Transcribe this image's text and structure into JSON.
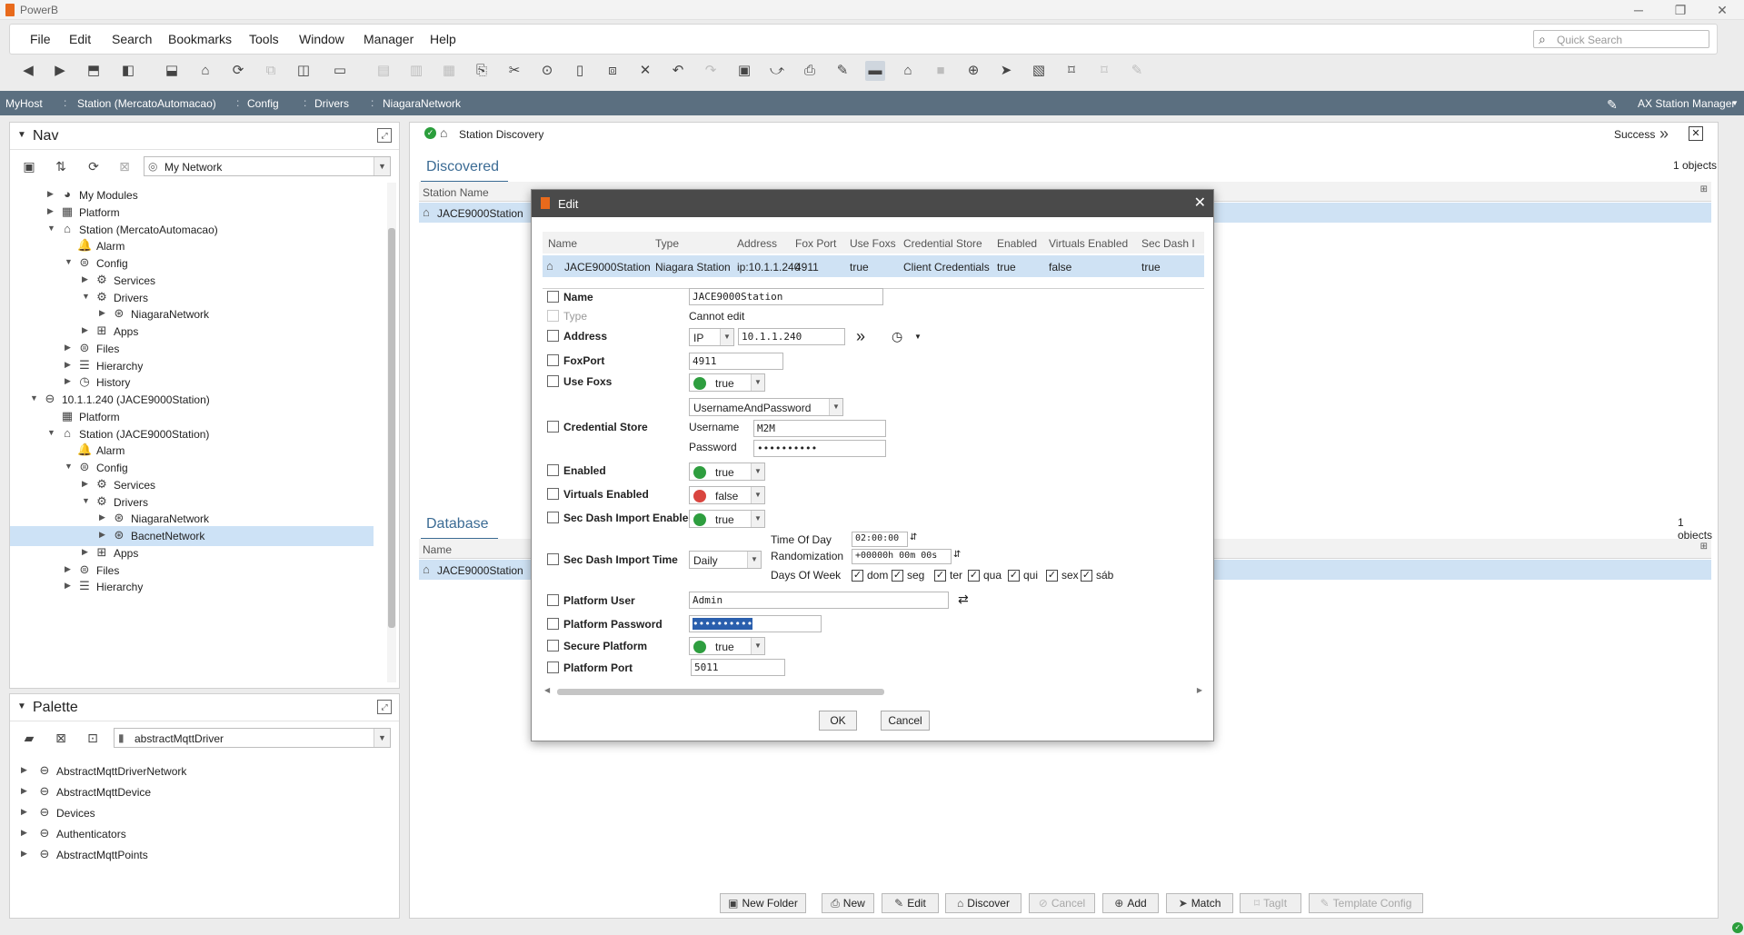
{
  "window": {
    "title": "PowerB"
  },
  "menu": [
    "File",
    "Edit",
    "Search",
    "Bookmarks",
    "Tools",
    "Window",
    "Manager",
    "Help"
  ],
  "quick_search": {
    "placeholder": "Quick Search"
  },
  "breadcrumb": [
    "MyHost",
    "Station (MercatoAutomacao)",
    "Config",
    "Drivers",
    "NiagaraNetwork"
  ],
  "view_selector": "AX Station Manager",
  "nav": {
    "title": "Nav",
    "combo": "My Network",
    "tree": [
      {
        "label": "My Modules",
        "indent": 1,
        "icon": "modules",
        "twisty": "r"
      },
      {
        "label": "Platform",
        "indent": 1,
        "icon": "platform",
        "twisty": "r"
      },
      {
        "label": "Station (MercatoAutomacao)",
        "indent": 1,
        "icon": "station",
        "twisty": "d"
      },
      {
        "label": "Alarm",
        "indent": 2,
        "icon": "alarm",
        "twisty": ""
      },
      {
        "label": "Config",
        "indent": 2,
        "icon": "config",
        "twisty": "d"
      },
      {
        "label": "Services",
        "indent": 3,
        "icon": "services",
        "twisty": "r"
      },
      {
        "label": "Drivers",
        "indent": 3,
        "icon": "drivers",
        "twisty": "d"
      },
      {
        "label": "NiagaraNetwork",
        "indent": 4,
        "icon": "network",
        "twisty": "r"
      },
      {
        "label": "Apps",
        "indent": 3,
        "icon": "apps",
        "twisty": "r"
      },
      {
        "label": "Files",
        "indent": 2,
        "icon": "files",
        "twisty": "r"
      },
      {
        "label": "Hierarchy",
        "indent": 2,
        "icon": "hierarchy",
        "twisty": "r"
      },
      {
        "label": "History",
        "indent": 2,
        "icon": "history",
        "twisty": "r"
      },
      {
        "label": "10.1.1.240 (JACE9000Station)",
        "indent": 0,
        "icon": "host",
        "twisty": "d"
      },
      {
        "label": "Platform",
        "indent": 1,
        "icon": "platform",
        "twisty": ""
      },
      {
        "label": "Station (JACE9000Station)",
        "indent": 1,
        "icon": "station",
        "twisty": "d"
      },
      {
        "label": "Alarm",
        "indent": 2,
        "icon": "alarm",
        "twisty": ""
      },
      {
        "label": "Config",
        "indent": 2,
        "icon": "config",
        "twisty": "d"
      },
      {
        "label": "Services",
        "indent": 3,
        "icon": "services",
        "twisty": "r"
      },
      {
        "label": "Drivers",
        "indent": 3,
        "icon": "drivers",
        "twisty": "d"
      },
      {
        "label": "NiagaraNetwork",
        "indent": 4,
        "icon": "network",
        "twisty": "r"
      },
      {
        "label": "BacnetNetwork",
        "indent": 4,
        "icon": "network",
        "twisty": "r",
        "selected": true
      },
      {
        "label": "Apps",
        "indent": 3,
        "icon": "apps",
        "twisty": "r"
      },
      {
        "label": "Files",
        "indent": 2,
        "icon": "files",
        "twisty": "r"
      },
      {
        "label": "Hierarchy",
        "indent": 2,
        "icon": "hierarchy",
        "twisty": "r"
      }
    ]
  },
  "palette": {
    "title": "Palette",
    "combo": "abstractMqttDriver",
    "items": [
      "AbstractMqttDriverNetwork",
      "AbstractMqttDevice",
      "Devices",
      "Authenticators",
      "AbstractMqttPoints"
    ]
  },
  "main": {
    "header_title": "Station Discovery",
    "status": "Success",
    "discovered": {
      "tab": "Discovered",
      "count": "1 objects",
      "column": "Station Name",
      "row": "JACE9000Station"
    },
    "database": {
      "tab": "Database",
      "count": "1 objects",
      "column": "Name",
      "row": "JACE9000Station"
    },
    "buttons": [
      {
        "label": "New Folder",
        "icon": "folder-icon",
        "enabled": true
      },
      {
        "label": "New",
        "icon": "new-icon",
        "enabled": true
      },
      {
        "label": "Edit",
        "icon": "edit-icon",
        "enabled": true
      },
      {
        "label": "Discover",
        "icon": "discover-icon",
        "enabled": true
      },
      {
        "label": "Cancel",
        "icon": "cancel-icon",
        "enabled": false
      },
      {
        "label": "Add",
        "icon": "add-icon",
        "enabled": true
      },
      {
        "label": "Match",
        "icon": "match-icon",
        "enabled": true
      },
      {
        "label": "TagIt",
        "icon": "tag-icon",
        "enabled": false
      },
      {
        "label": "Template Config",
        "icon": "template-icon",
        "enabled": false
      }
    ]
  },
  "dialog": {
    "title": "Edit",
    "columns": [
      "Name",
      "Type",
      "Address",
      "Fox Port",
      "Use Foxs",
      "Credential Store",
      "Enabled",
      "Virtuals Enabled",
      "Sec Dash I"
    ],
    "row": [
      "JACE9000Station",
      "Niagara Station",
      "ip:10.1.1.240",
      "4911",
      "true",
      "Client Credentials",
      "true",
      "false",
      "true"
    ],
    "props": {
      "name_label": "Name",
      "name_value": "JACE9000Station",
      "type_label": "Type",
      "type_value": "Cannot edit",
      "address_label": "Address",
      "address_scheme": "IP",
      "address_value": "10.1.1.240",
      "foxport_label": "FoxPort",
      "foxport_value": "4911",
      "usefoxs_label": "Use Foxs",
      "usefoxs_value": "true",
      "cred_label": "Credential Store",
      "cred_type": "UsernameAndPassword",
      "username_label": "Username",
      "username_value": "M2M",
      "password_label": "Password",
      "password_value": "••••••••••",
      "enabled_label": "Enabled",
      "enabled_value": "true",
      "virtuals_label": "Virtuals Enabled",
      "virtuals_value": "false",
      "secdash_enabled_label": "Sec Dash Import Enabled",
      "secdash_enabled_value": "true",
      "secdash_time_label": "Sec Dash Import Time",
      "secdash_time_mode": "Daily",
      "tod_label": "Time Of Day",
      "tod_value": "02:00:00",
      "rand_label": "Randomization",
      "rand_value": "+00000h 00m 00s",
      "dow_label": "Days Of Week",
      "days": [
        "dom",
        "seg",
        "ter",
        "qua",
        "qui",
        "sex",
        "sáb"
      ],
      "pu_label": "Platform User",
      "pu_value": "Admin",
      "pp_label": "Platform Password",
      "pp_value": "••••••••••",
      "sp_label": "Secure Platform",
      "sp_value": "true",
      "pport_label": "Platform Port",
      "pport_value": "5011"
    },
    "ok": "OK",
    "cancel": "Cancel"
  },
  "colors": {
    "crumb_bg": "#5b6f80",
    "true_dot": "#2e9e3f",
    "false_dot": "#d9453f",
    "selection": "#cfe2f4",
    "accent_tab": "#3b6b94"
  }
}
